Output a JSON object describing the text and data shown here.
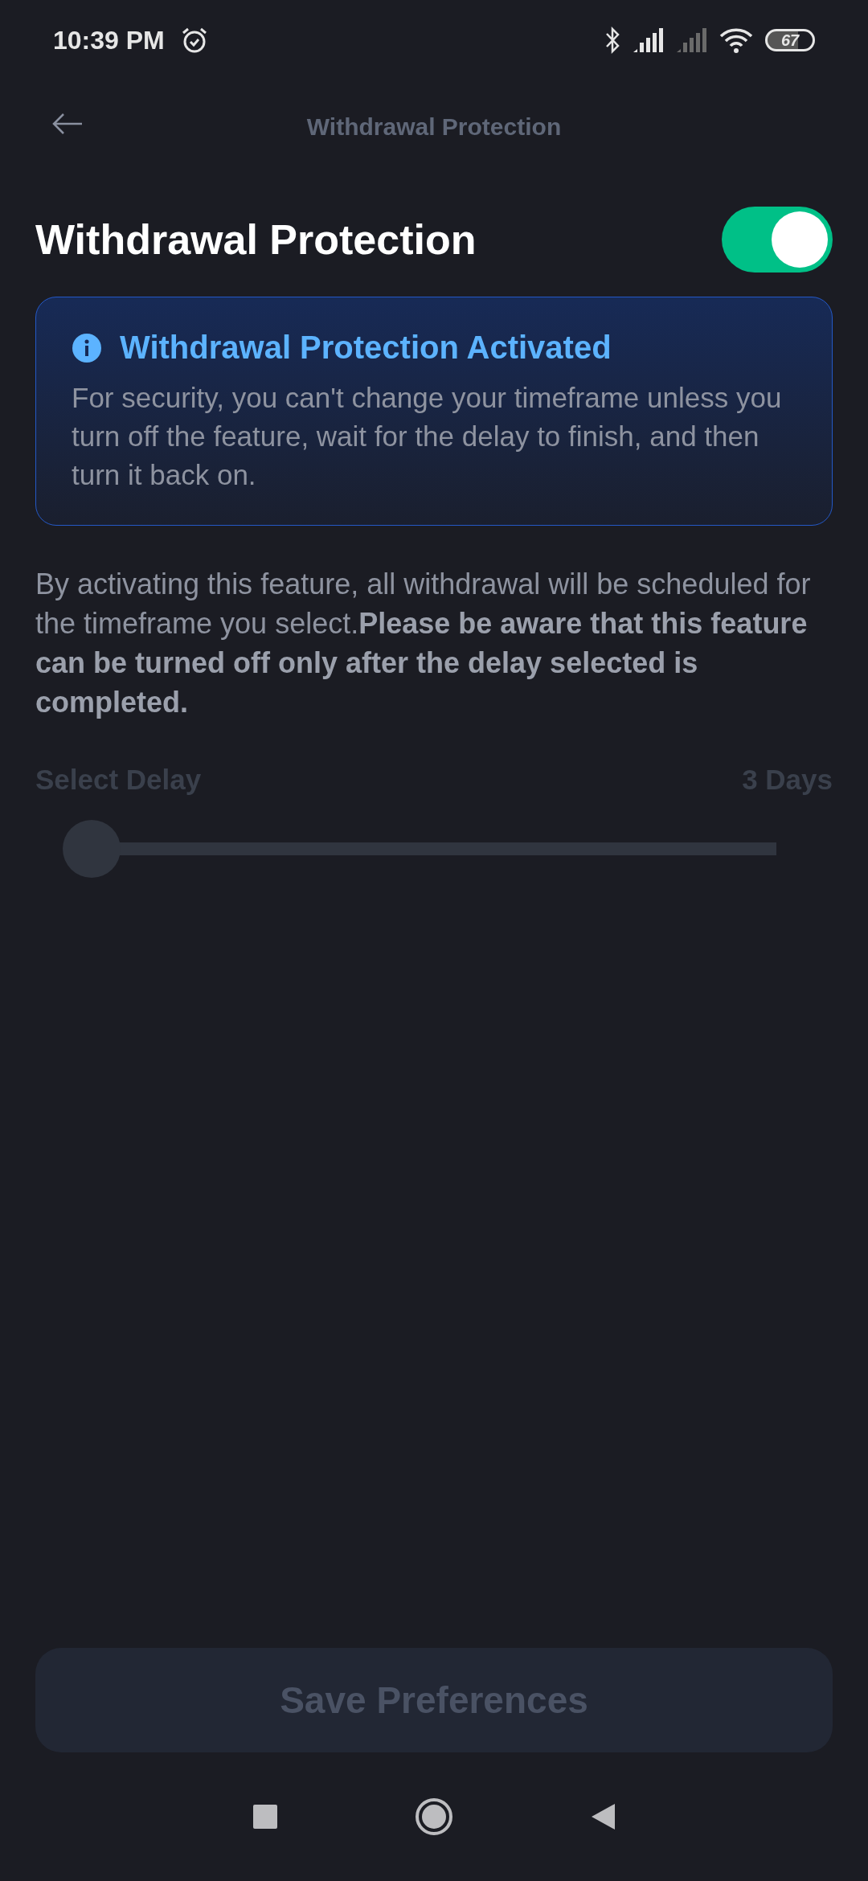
{
  "status_bar": {
    "time": "10:39 PM",
    "battery": "67"
  },
  "header": {
    "title": "Withdrawal Protection"
  },
  "setting": {
    "title": "Withdrawal Protection",
    "on": true
  },
  "notice": {
    "title": "Withdrawal Protection Activated",
    "body": "For security, you can't change your timeframe unless you turn off the feature, wait for the delay to finish, and then turn it back on."
  },
  "description": "By activating this feature, all withdrawal will be scheduled for the timeframe you select.**Please be aware that this feature can be turned off only after the delay selected is completed.**",
  "slider": {
    "label": "Select Delay",
    "value_text": "3 Days",
    "level": 0,
    "disabled": true
  },
  "save_button": {
    "label": "Save Preferences",
    "disabled": true
  }
}
